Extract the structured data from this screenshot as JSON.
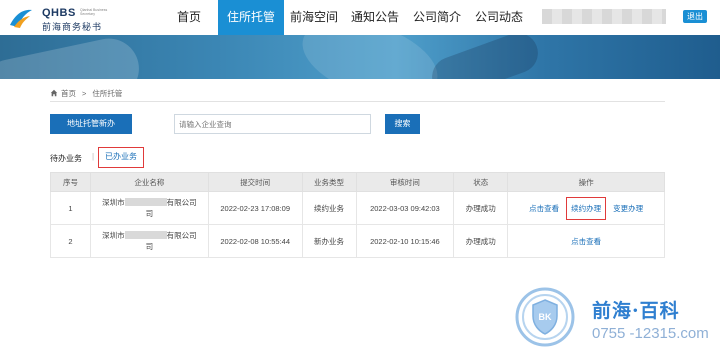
{
  "header": {
    "logo_en": "QHBS",
    "logo_en_sub": "Qianhai Business Secretary",
    "logo_cn": "前海商务秘书",
    "nav": [
      {
        "label": "首页"
      },
      {
        "label": "住所托管"
      },
      {
        "label": "前海空间"
      },
      {
        "label": "通知公告"
      },
      {
        "label": "公司简介"
      },
      {
        "label": "公司动态"
      }
    ],
    "logout_label": "退出"
  },
  "breadcrumb": {
    "home": "首页",
    "separator": ">",
    "current": "住所托管"
  },
  "toolbar": {
    "new_label": "地址托管新办",
    "search_placeholder": "请输入企业查询",
    "search_label": "搜索"
  },
  "tabs": {
    "pending": "待办业务",
    "separator": "|",
    "done": "已办业务"
  },
  "table": {
    "headers": [
      "序号",
      "企业名称",
      "提交时间",
      "业务类型",
      "审核时间",
      "状态",
      "操作"
    ],
    "rows": [
      {
        "no": "1",
        "name_prefix": "深圳市",
        "name_suffix": "有限公司",
        "name_tail": "司",
        "submit_time": "2022-02-23 17:08:09",
        "type": "续约业务",
        "audit_time": "2022-03-03 09:42:03",
        "status": "办理成功",
        "ops": [
          "点击查看",
          "续约办理",
          "变更办理"
        ]
      },
      {
        "no": "2",
        "name_prefix": "深圳市",
        "name_suffix": "有限公司",
        "name_tail": "司",
        "submit_time": "2022-02-08 10:55:44",
        "type": "新办业务",
        "audit_time": "2022-02-10 10:15:46",
        "status": "办理成功",
        "ops": [
          "点击查看"
        ]
      }
    ]
  },
  "watermark": {
    "title": "前海·百科",
    "url": "0755 -12315.com",
    "badge": "BK"
  },
  "colors": {
    "primary": "#1a6fb8",
    "nav_active": "#1a8fd4",
    "highlight_border": "#e03a3a"
  }
}
